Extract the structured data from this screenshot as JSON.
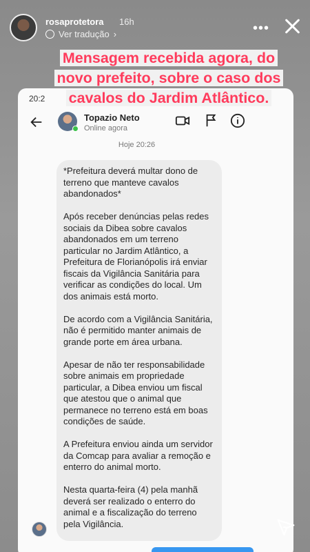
{
  "story": {
    "username": "rosaprotetora",
    "time_ago": "16h",
    "translate_label": "Ver tradução",
    "translate_chevron": "›",
    "more_label": "•••"
  },
  "caption": {
    "line1": "Mensagem recebida agora, do",
    "line2": "novo prefeito, sobre o caso dos",
    "line3": "cavalos do Jardim Atlântico."
  },
  "screenshot": {
    "status_time": "20:2",
    "contact_name": "Topazio Neto",
    "contact_status": "Online agora",
    "date_label": "Hoje 20:26",
    "message": [
      "*Prefeitura deverá multar dono de terreno que manteve cavalos abandonados*",
      "Após receber denúncias pelas redes sociais da Dibea sobre cavalos abandonados em um terreno particular no Jardim Atlântico, a Prefeitura de Florianópolis irá enviar fiscais da Vigilância Sanitária para verificar as condições do local. Um dos animais está morto.",
      "De acordo com a Vigilância Sanitária, não é permitido manter animais de grande porte em área urbana.",
      "Apesar de não ter responsabilidade sobre animais em propriedade particular, a Dibea enviou um fiscal que atestou que o animal que permanece no terreno está em boas condições de saúde.",
      "A Prefeitura enviou ainda um servidor da Comcap para avaliar a remoção e enterro do animal morto.",
      "Nesta quarta-feira (4) pela manhã deverá ser realizado o enterro do animal e a fiscalização do terreno pela Vigilância."
    ]
  },
  "icons": {
    "back": "arrow-left-icon",
    "video": "video-call-icon",
    "flag": "flag-icon",
    "info": "info-icon",
    "close": "close-icon",
    "send": "send-icon"
  },
  "colors": {
    "caption_text": "#ff3b5c",
    "caption_bg": "#f1f1f1",
    "online": "#3cc14a",
    "reply_bar": "#3897f0"
  }
}
